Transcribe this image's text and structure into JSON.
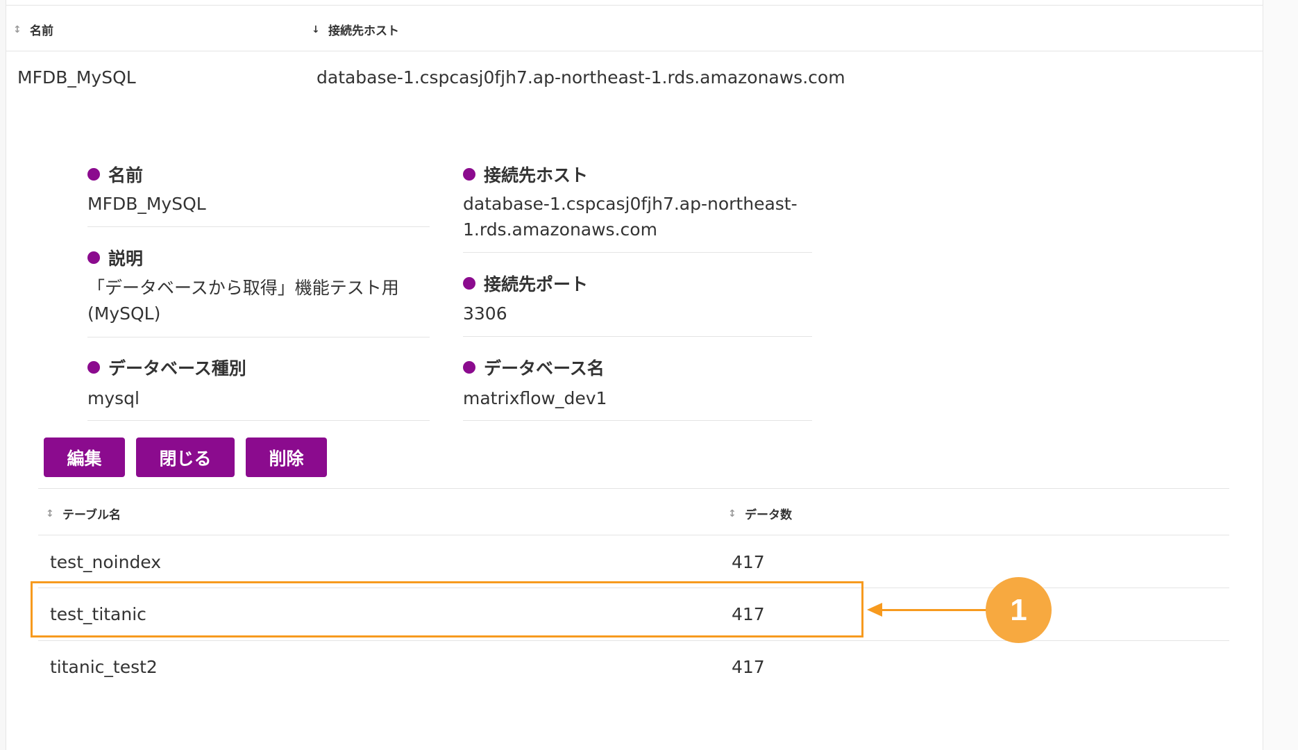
{
  "top_table": {
    "headers": [
      {
        "label": "名前",
        "sort_icon": "↕"
      },
      {
        "label": "接続先ホスト",
        "sort_icon": "↓"
      }
    ],
    "row": {
      "name": "MFDB_MySQL",
      "host": "database-1.cspcasj0fjh7.ap-northeast-1.rds.amazonaws.com"
    }
  },
  "details": {
    "name_label": "名前",
    "name_value": "MFDB_MySQL",
    "desc_label": "説明",
    "desc_value_line1": "「データベースから取得」機能テスト用",
    "desc_value_line2": "(MySQL)",
    "type_label": "データベース種別",
    "type_value": "mysql",
    "host_label": "接続先ホスト",
    "host_value_line1": "database-1.cspcasj0fjh7.ap-northeast-",
    "host_value_line2": "1.rds.amazonaws.com",
    "port_label": "接続先ポート",
    "port_value": "3306",
    "dbname_label": "データベース名",
    "dbname_value": "matrixflow_dev1"
  },
  "buttons": {
    "edit": "編集",
    "close": "閉じる",
    "delete": "削除"
  },
  "tables_list": {
    "headers": [
      {
        "label": "テーブル名",
        "sort_icon": "↕"
      },
      {
        "label": "データ数",
        "sort_icon": "↕"
      }
    ],
    "rows": [
      {
        "name": "test_noindex",
        "count": "417"
      },
      {
        "name": "test_titanic",
        "count": "417"
      },
      {
        "name": "titanic_test2",
        "count": "417"
      }
    ]
  },
  "annotation": {
    "badge_number": "1",
    "color": "#f79a1e"
  },
  "colors": {
    "accent": "#8b0b8e"
  }
}
